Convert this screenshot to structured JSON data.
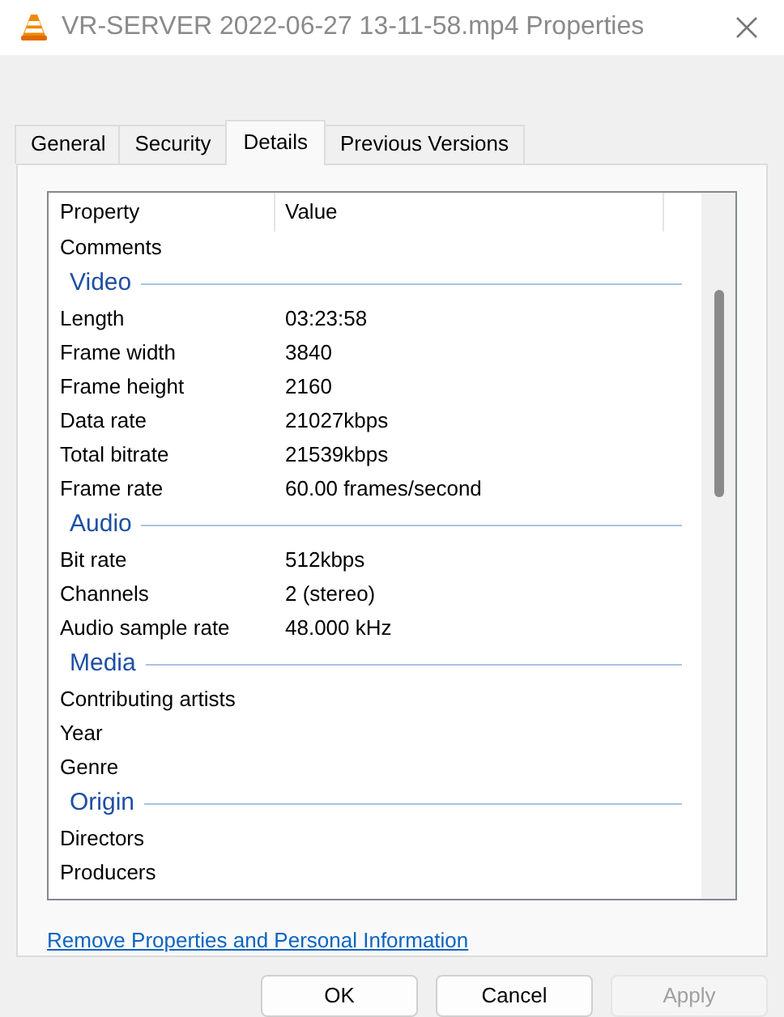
{
  "window": {
    "title": "VR-SERVER 2022-06-27 13-11-58.mp4 Properties"
  },
  "tabs": [
    {
      "label": "General",
      "selected": false
    },
    {
      "label": "Security",
      "selected": false
    },
    {
      "label": "Details",
      "selected": true
    },
    {
      "label": "Previous Versions",
      "selected": false
    }
  ],
  "table": {
    "columns": [
      "Property",
      "Value"
    ],
    "rows": [
      {
        "kind": "property",
        "property": "Comments"
      },
      {
        "kind": "group",
        "label": "Video"
      },
      {
        "kind": "property",
        "property": "Length",
        "value": "03:23:58"
      },
      {
        "kind": "property",
        "property": "Frame width",
        "value": "3840"
      },
      {
        "kind": "property",
        "property": "Frame height",
        "value": "2160"
      },
      {
        "kind": "property",
        "property": "Data rate",
        "value": "21027kbps"
      },
      {
        "kind": "property",
        "property": "Total bitrate",
        "value": "21539kbps"
      },
      {
        "kind": "property",
        "property": "Frame rate",
        "value": "60.00 frames/second"
      },
      {
        "kind": "group",
        "label": "Audio"
      },
      {
        "kind": "property",
        "property": "Bit rate",
        "value": "512kbps"
      },
      {
        "kind": "property",
        "property": "Channels",
        "value": "2 (stereo)"
      },
      {
        "kind": "property",
        "property": "Audio sample rate",
        "value": "48.000 kHz"
      },
      {
        "kind": "group",
        "label": "Media"
      },
      {
        "kind": "property",
        "property": "Contributing artists"
      },
      {
        "kind": "property",
        "property": "Year"
      },
      {
        "kind": "property",
        "property": "Genre"
      },
      {
        "kind": "group",
        "label": "Origin"
      },
      {
        "kind": "property",
        "property": "Directors"
      },
      {
        "kind": "property",
        "property": "Producers"
      }
    ]
  },
  "link": "Remove Properties and Personal Information",
  "buttons": [
    {
      "label": "OK",
      "disabled": false
    },
    {
      "label": "Cancel",
      "disabled": false
    },
    {
      "label": "Apply",
      "disabled": true
    }
  ]
}
